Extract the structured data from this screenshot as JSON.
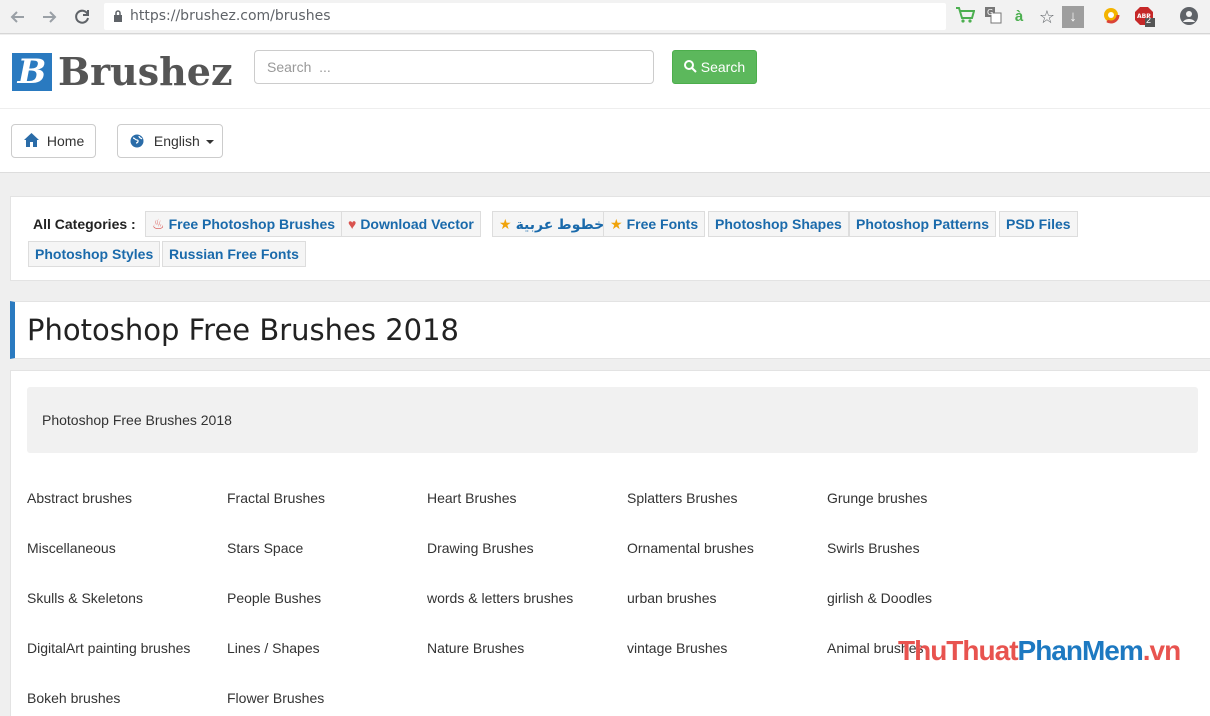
{
  "browser": {
    "url": "https://brushez.com/brushes",
    "extension_icons": [
      "cart-icon",
      "translate-icon",
      "dictionary-icon",
      "star-icon",
      "download-icon",
      "chrome-ext-icon",
      "adblock-icon",
      "account-icon"
    ],
    "adblock_count": "2"
  },
  "header": {
    "logo_letter": "B",
    "logo_text": "Brushez",
    "search_placeholder": "Search  ...",
    "search_button": "Search",
    "home_label": "Home",
    "language_label": "English"
  },
  "categories": {
    "title": "All Categories :",
    "items": [
      {
        "label": "Free Photoshop Brushes",
        "icon": "fire-icon"
      },
      {
        "label": "Download Vector",
        "icon": "heart-icon"
      },
      {
        "label": "خطوط عربية",
        "icon": "star-icon"
      },
      {
        "label": "Free Fonts",
        "icon": "star-icon"
      },
      {
        "label": "Photoshop Shapes"
      },
      {
        "label": "Photoshop Patterns"
      },
      {
        "label": "PSD Files"
      },
      {
        "label": "Photoshop Styles"
      },
      {
        "label": "Russian Free Fonts"
      }
    ]
  },
  "page": {
    "title": "Photoshop Free Brushes 2018",
    "description": "Photoshop Free Brushes 2018"
  },
  "brush_links": [
    [
      "Abstract brushes",
      "Fractal Brushes",
      "Heart Brushes",
      "Splatters Brushes",
      "Grunge brushes"
    ],
    [
      "Miscellaneous",
      "Stars Space",
      "Drawing Brushes",
      "Ornamental brushes",
      "Swirls Brushes"
    ],
    [
      "Skulls & Skeletons",
      "People Bushes",
      "words & letters brushes",
      "urban brushes",
      "girlish & Doodles"
    ],
    [
      "DigitalArt painting brushes",
      "Lines / Shapes",
      "Nature Brushes",
      "vintage Brushes",
      "Animal brushes"
    ],
    [
      "Bokeh brushes",
      "Flower Brushes"
    ]
  ],
  "watermark": {
    "part1": "ThuThuat",
    "part2": "PhanMem",
    "part3": ".vn"
  },
  "colors": {
    "accent": "#2a7ac0",
    "search_green": "#5cb85c",
    "tag_link": "#1a6aab"
  }
}
